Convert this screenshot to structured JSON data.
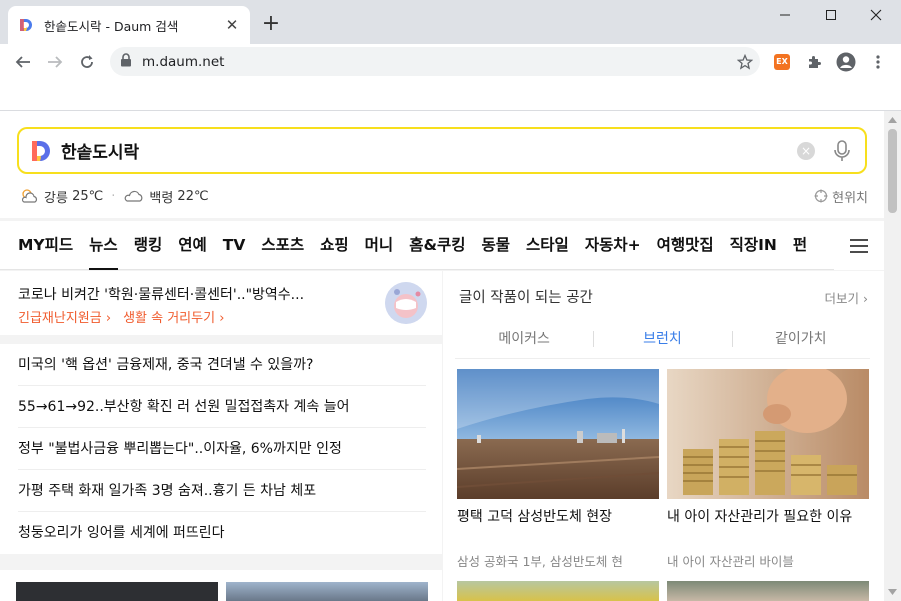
{
  "browser": {
    "tab_title": "한솥도시락 - Daum 검색",
    "url": "m.daum.net",
    "ext_label": "EX"
  },
  "search": {
    "query": "한솥도시락",
    "clear_label": "×"
  },
  "weather": [
    {
      "city": "강릉",
      "temp": "25℃"
    },
    {
      "city": "백령",
      "temp": "22℃"
    }
  ],
  "location_label": "현위치",
  "menu": [
    {
      "label": "MY피드"
    },
    {
      "label": "뉴스"
    },
    {
      "label": "랭킹"
    },
    {
      "label": "연예"
    },
    {
      "label": "TV"
    },
    {
      "label": "스포츠"
    },
    {
      "label": "쇼핑"
    },
    {
      "label": "머니"
    },
    {
      "label": "홈&쿠킹"
    },
    {
      "label": "동물"
    },
    {
      "label": "스타일"
    },
    {
      "label": "자동차+"
    },
    {
      "label": "여행맛집"
    },
    {
      "label": "직장IN"
    },
    {
      "label": "펀"
    }
  ],
  "menu_active_index": 1,
  "covid": {
    "title": "코로나 비켜간 '학원·물류센터·콜센터'..\"방역수...",
    "link1": "긴급재난지원금",
    "link2": "생활 속 거리두기"
  },
  "news": [
    "미국의 '핵 옵션' 금융제재, 중국 견뎌낼 수 있을까?",
    "55→61→92..부산항 확진 러 선원 밀접접촉자 계속 늘어",
    "정부 \"불법사금융 뿌리뽑는다\"..이자율, 6%까지만 인정",
    "가평 주택 화재 일가족 3명 숨져..흉기 든 차남 체포",
    "청둥오리가 잉어를 세계에 퍼뜨린다"
  ],
  "brunch": {
    "title": "글이 작품이 되는 공간",
    "more": "더보기",
    "tabs": [
      "메이커스",
      "브런치",
      "같이가치"
    ],
    "active_tab": 1,
    "cards": [
      {
        "title": "평택 고덕 삼성반도체 현장",
        "sub": "삼성 공화국 1부, 삼성반도체 현"
      },
      {
        "title": "내 아이 자산관리가 필요한 이유",
        "sub": "내 아이 자산관리 바이블"
      }
    ]
  },
  "colors": {
    "search_border": "#f7df1d",
    "accent_blue": "#3a7ee8",
    "covid_orange": "#f05b2d"
  }
}
